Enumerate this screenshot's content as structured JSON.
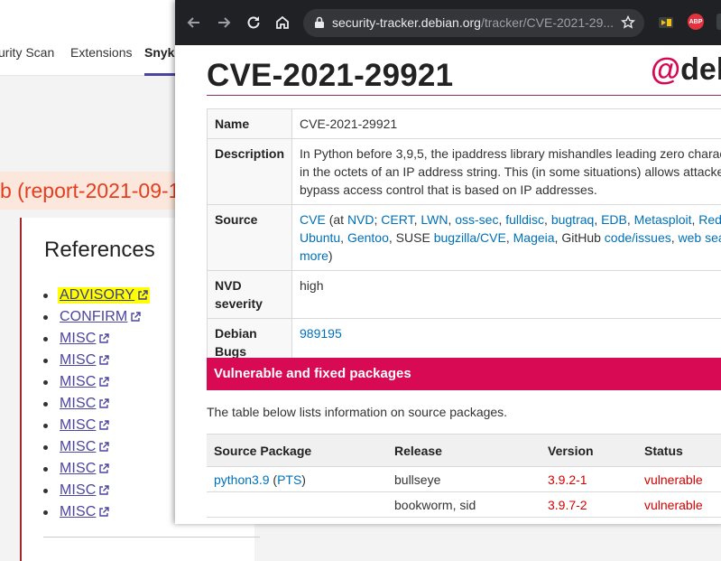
{
  "background_page": {
    "tabs": [
      {
        "label": "urity Scan"
      },
      {
        "label": "Extensions"
      },
      {
        "label": "Snyk"
      }
    ],
    "report_heading": "b (report-2021-09-1",
    "references_title": "References",
    "references": [
      {
        "label": "ADVISORY"
      },
      {
        "label": "CONFIRM"
      },
      {
        "label": "MISC"
      },
      {
        "label": "MISC"
      },
      {
        "label": "MISC"
      },
      {
        "label": "MISC"
      },
      {
        "label": "MISC"
      },
      {
        "label": "MISC"
      },
      {
        "label": "MISC"
      },
      {
        "label": "MISC"
      },
      {
        "label": "MISC"
      }
    ]
  },
  "browser": {
    "url_host": "security-tracker.debian.org",
    "url_path": "/tracker/CVE-2021-29...",
    "extensions": [
      "ABP"
    ]
  },
  "page": {
    "title": "CVE-2021-29921",
    "logo_text": "debi",
    "info": {
      "name_label": "Name",
      "name_value": "CVE-2021-29921",
      "description_label": "Description",
      "description_lines": [
        "In Python before 3,9,5, the ipaddress library mishandles leading zero charac",
        "in the octets of an IP address string. This (in some situations) allows attacke",
        "bypass access control that is based on IP addresses."
      ],
      "source_label": "Source",
      "source_line1_prefix": "(at ",
      "source_links_line1": [
        "CVE",
        "NVD",
        "CERT",
        "LWN",
        "oss-sec",
        "fulldisc",
        "bugtraq",
        "EDB",
        "Metasploit",
        "Red"
      ],
      "source_links_line2": [
        "Ubuntu",
        "Gentoo"
      ],
      "source_suse": "SUSE",
      "source_suse_link": "bugzilla/CVE",
      "source_mageia": "Mageia",
      "source_github": "GitHub",
      "source_github_links": [
        "code/issues",
        "web sea"
      ],
      "source_more": "more",
      "nvd_label_1": "NVD",
      "nvd_label_2": "severity",
      "nvd_value": "high",
      "bugs_label_1": "Debian",
      "bugs_label_2": "Bugs",
      "bugs_value": "989195"
    },
    "vuln_header": "Vulnerable and fixed packages",
    "vuln_desc": "The table below lists information on source packages.",
    "pkg_columns": [
      "Source Package",
      "Release",
      "Version",
      "Status"
    ],
    "pkg_rows": [
      {
        "package": "python3.9",
        "pts": "PTS",
        "release": "bullseye",
        "version": "3.9.2-1",
        "status": "vulnerable"
      },
      {
        "package": "",
        "pts": "",
        "release": "bookworm, sid",
        "version": "3.9.7-2",
        "status": "vulnerable"
      }
    ]
  },
  "colors": {
    "debian_red": "#d70a53",
    "link_blue": "#0070b8",
    "vulnerable_red": "#d40000",
    "highlight_yellow": "#ffff00"
  }
}
